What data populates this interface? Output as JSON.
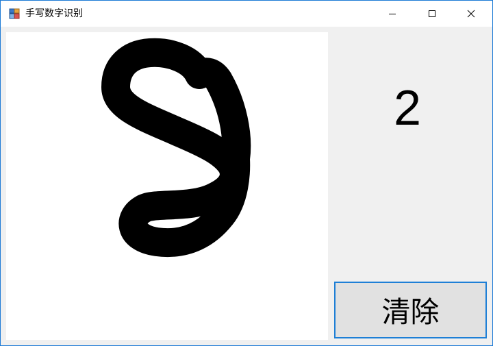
{
  "window": {
    "title": "手写数字识别",
    "icon": "app-window-icon",
    "controls": {
      "minimize_icon": "minimize-icon",
      "maximize_icon": "maximize-icon",
      "close_icon": "close-icon"
    }
  },
  "drawing_canvas": {
    "background": "#ffffff",
    "stroke_color": "#000000"
  },
  "result": {
    "digit": "2"
  },
  "clear_button": {
    "label": "清除",
    "border_color": "#1e7fd6"
  }
}
